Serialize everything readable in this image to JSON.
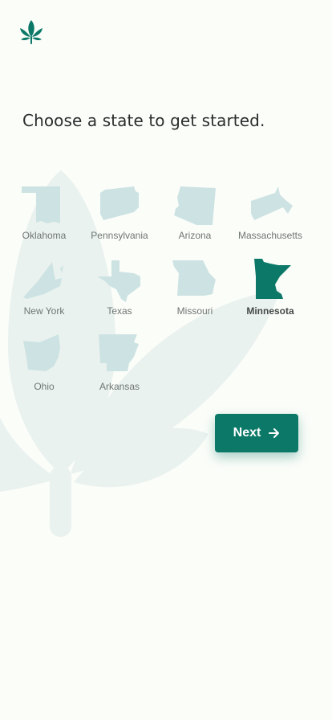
{
  "prompt": {
    "title": "Choose a state to get started."
  },
  "colors": {
    "accent": "#0b7868",
    "state_unselected": "#cde3e3",
    "background_leaf": "#eaf2ef",
    "background": "#fbfdf9"
  },
  "icons": {
    "logo": "leaf-icon",
    "next": "arrow-right-icon"
  },
  "states": [
    {
      "label": "Oklahoma",
      "selected": false
    },
    {
      "label": "Pennsylvania",
      "selected": false
    },
    {
      "label": "Arizona",
      "selected": false
    },
    {
      "label": "Massachusetts",
      "selected": false
    },
    {
      "label": "New York",
      "selected": false
    },
    {
      "label": "Texas",
      "selected": false
    },
    {
      "label": "Missouri",
      "selected": false
    },
    {
      "label": "Minnesota",
      "selected": true
    },
    {
      "label": "Ohio",
      "selected": false
    },
    {
      "label": "Arkansas",
      "selected": false
    }
  ],
  "actions": {
    "next_label": "Next"
  }
}
